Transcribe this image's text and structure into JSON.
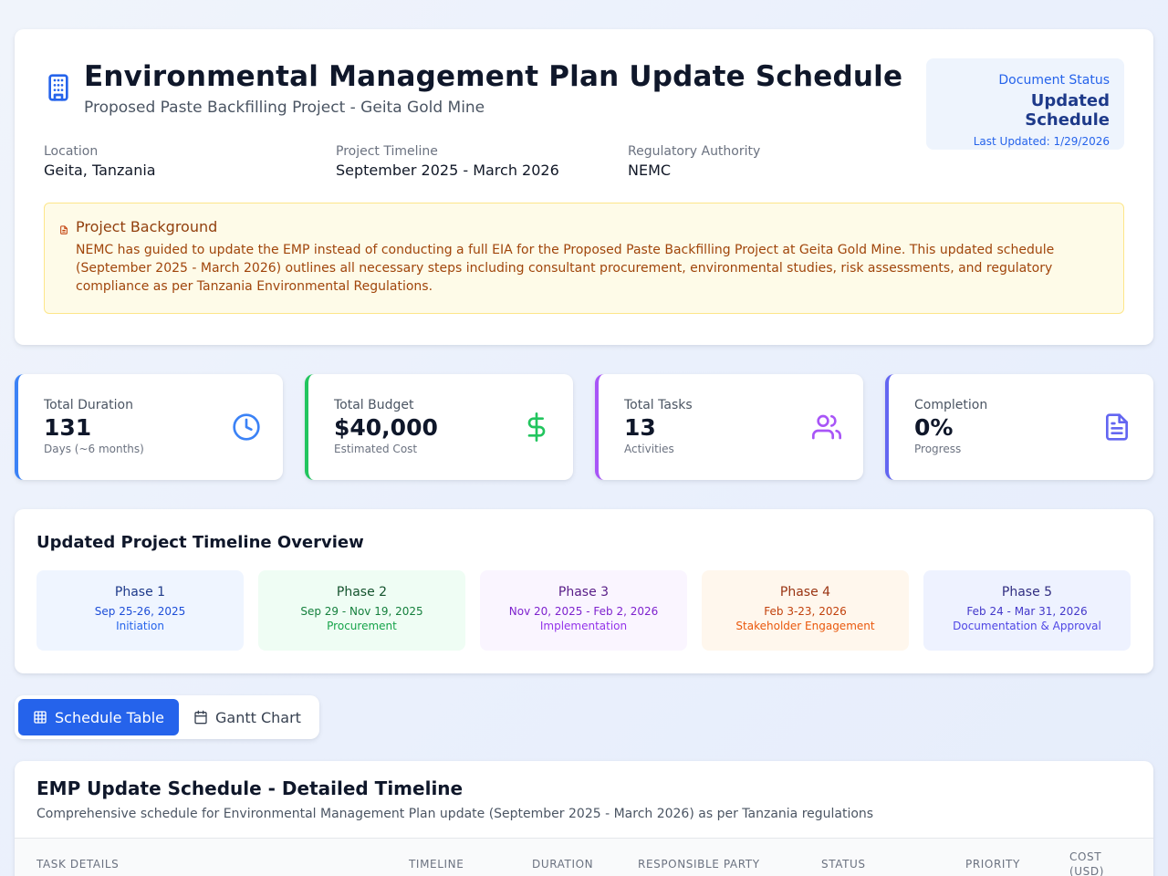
{
  "header": {
    "title": "Environmental Management Plan Update Schedule",
    "subtitle": "Proposed Paste Backfilling Project - Geita Gold Mine",
    "status_label": "Document Status",
    "status_value": "Updated Schedule",
    "last_updated": "Last Updated: 1/29/2026",
    "meta": [
      {
        "label": "Location",
        "value": "Geita, Tanzania"
      },
      {
        "label": "Project Timeline",
        "value": "September 2025 - March 2026"
      },
      {
        "label": "Regulatory Authority",
        "value": "NEMC"
      }
    ],
    "background": {
      "title": "Project Background",
      "text": "NEMC has guided to update the EMP instead of conducting a full EIA for the Proposed Paste Backfilling Project at Geita Gold Mine. This updated schedule (September 2025 - March 2026) outlines all necessary steps including consultant procurement, environmental studies, risk assessments, and regulatory compliance as per Tanzania Environmental Regulations."
    }
  },
  "stats": [
    {
      "label": "Total Duration",
      "value": "131",
      "sub": "Days (~6 months)",
      "icon": "clock-icon",
      "color": "#3b82f6"
    },
    {
      "label": "Total Budget",
      "value": "$40,000",
      "sub": "Estimated Cost",
      "icon": "dollar-icon",
      "color": "#22c55e"
    },
    {
      "label": "Total Tasks",
      "value": "13",
      "sub": "Activities",
      "icon": "users-icon",
      "color": "#a855f7"
    },
    {
      "label": "Completion",
      "value": "0%",
      "sub": "Progress",
      "icon": "document-icon",
      "color": "#6366f1"
    }
  ],
  "overview": {
    "title": "Updated Project Timeline Overview",
    "phases": [
      {
        "name": "Phase 1",
        "dates": "Sep 25-26, 2025",
        "stage": "Initiation"
      },
      {
        "name": "Phase 2",
        "dates": "Sep 29 - Nov 19, 2025",
        "stage": "Procurement"
      },
      {
        "name": "Phase 3",
        "dates": "Nov 20, 2025 - Feb 2, 2026",
        "stage": "Implementation"
      },
      {
        "name": "Phase 4",
        "dates": "Feb 3-23, 2026",
        "stage": "Stakeholder Engagement"
      },
      {
        "name": "Phase 5",
        "dates": "Feb 24 - Mar 31, 2026",
        "stage": "Documentation & Approval"
      }
    ]
  },
  "tabs": {
    "schedule_table": "Schedule Table",
    "gantt_chart": "Gantt Chart"
  },
  "detail": {
    "title": "EMP Update Schedule - Detailed Timeline",
    "description": "Comprehensive schedule for Environmental Management Plan update (September 2025 - March 2026) as per Tanzania regulations",
    "columns": [
      "Task Details",
      "Timeline",
      "Duration",
      "Responsible Party",
      "Status",
      "Priority",
      "Cost (USD)"
    ]
  }
}
